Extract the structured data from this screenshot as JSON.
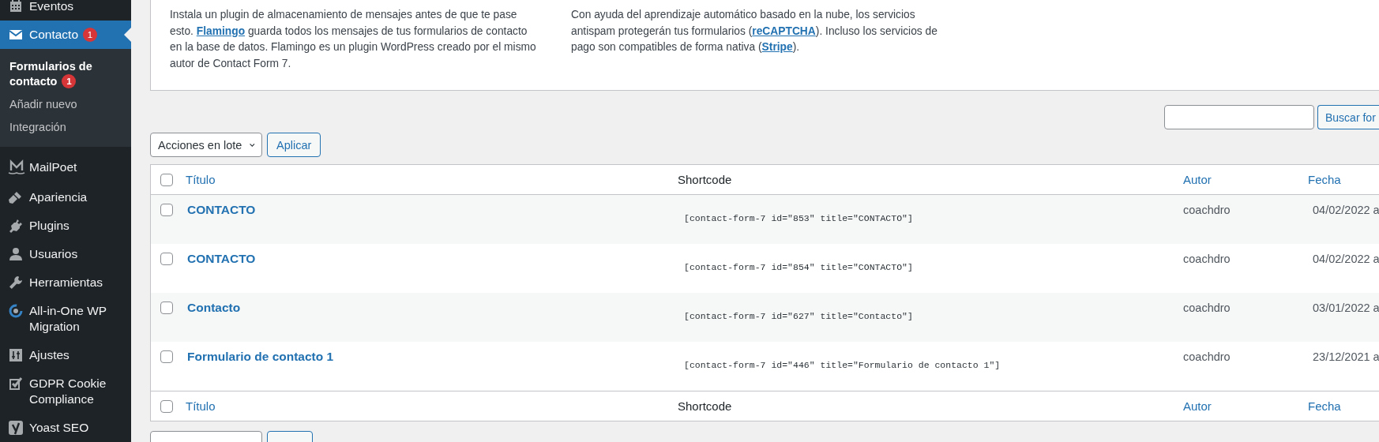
{
  "sidebar": {
    "items": [
      {
        "label": "Eventos",
        "selected": false
      },
      {
        "label": "Contacto",
        "selected": true,
        "badge": "1",
        "children": [
          {
            "label": "Formularios de contacto",
            "selected": true,
            "badge": "1"
          },
          {
            "label": "Añadir nuevo",
            "selected": false
          },
          {
            "label": "Integración",
            "selected": false
          }
        ]
      },
      {
        "label": "MailPoet",
        "selected": false
      },
      {
        "label": "Apariencia",
        "selected": false
      },
      {
        "label": "Plugins",
        "selected": false
      },
      {
        "label": "Usuarios",
        "selected": false
      },
      {
        "label": "Herramientas",
        "selected": false
      },
      {
        "label": "All-in-One WP Migration",
        "selected": false
      },
      {
        "label": "Ajustes",
        "selected": false
      },
      {
        "label": "GDPR Cookie Compliance",
        "selected": false
      },
      {
        "label": "Yoast SEO",
        "selected": false
      }
    ]
  },
  "notice": {
    "columns": [
      {
        "text": "Instala un plugin de almacenamiento de mensajes antes de que te pase esto. **Flamingo** guarda todos los mensajes de tus formularios de contacto en la base de datos. Flamingo es un plugin WordPress creado por el mismo autor de Contact Form 7."
      },
      {
        "text": "Con ayuda del aprendizaje automático basado en la nube, los servicios antispam protegerán tus formularios (**reCAPTCHA**). Incluso los servicios de pago son compatibles de forma nativa (**Stripe**)."
      }
    ]
  },
  "search": {
    "button": "Buscar for"
  },
  "bulk_actions": {
    "select": "Acciones en lote",
    "apply": "Aplicar"
  },
  "table": {
    "header_checked": false,
    "columns": [
      {
        "label": "Título",
        "sortable": true
      },
      {
        "label": "Shortcode",
        "sortable": false
      },
      {
        "label": "Autor",
        "sortable": true
      },
      {
        "label": "Fecha",
        "sortable": true
      }
    ],
    "rows": [
      {
        "checked": false,
        "title": "CONTACTO",
        "shortcode": "[contact-form-7 id=\"853\" title=\"CONTACTO\"]",
        "author": "coachdro",
        "date": "04/02/2022 a"
      },
      {
        "checked": false,
        "title": "CONTACTO",
        "shortcode": "[contact-form-7 id=\"854\" title=\"CONTACTO\"]",
        "author": "coachdro",
        "date": "04/02/2022 a"
      },
      {
        "checked": false,
        "title": "Contacto",
        "shortcode": "[contact-form-7 id=\"627\" title=\"Contacto\"]",
        "author": "coachdro",
        "date": "03/01/2022 a"
      },
      {
        "checked": false,
        "title": "Formulario de contacto 1",
        "shortcode": "[contact-form-7 id=\"446\" title=\"Formulario de contacto 1\"]",
        "author": "coachdro",
        "date": "23/12/2021 a"
      }
    ],
    "footer_checked": false,
    "footer_columns": [
      {
        "label": "Título",
        "sortable": true
      },
      {
        "label": "Shortcode",
        "sortable": false
      },
      {
        "label": "Autor",
        "sortable": true
      },
      {
        "label": "Fecha",
        "sortable": true
      }
    ]
  },
  "bottom_actions": {
    "shown": true
  }
}
